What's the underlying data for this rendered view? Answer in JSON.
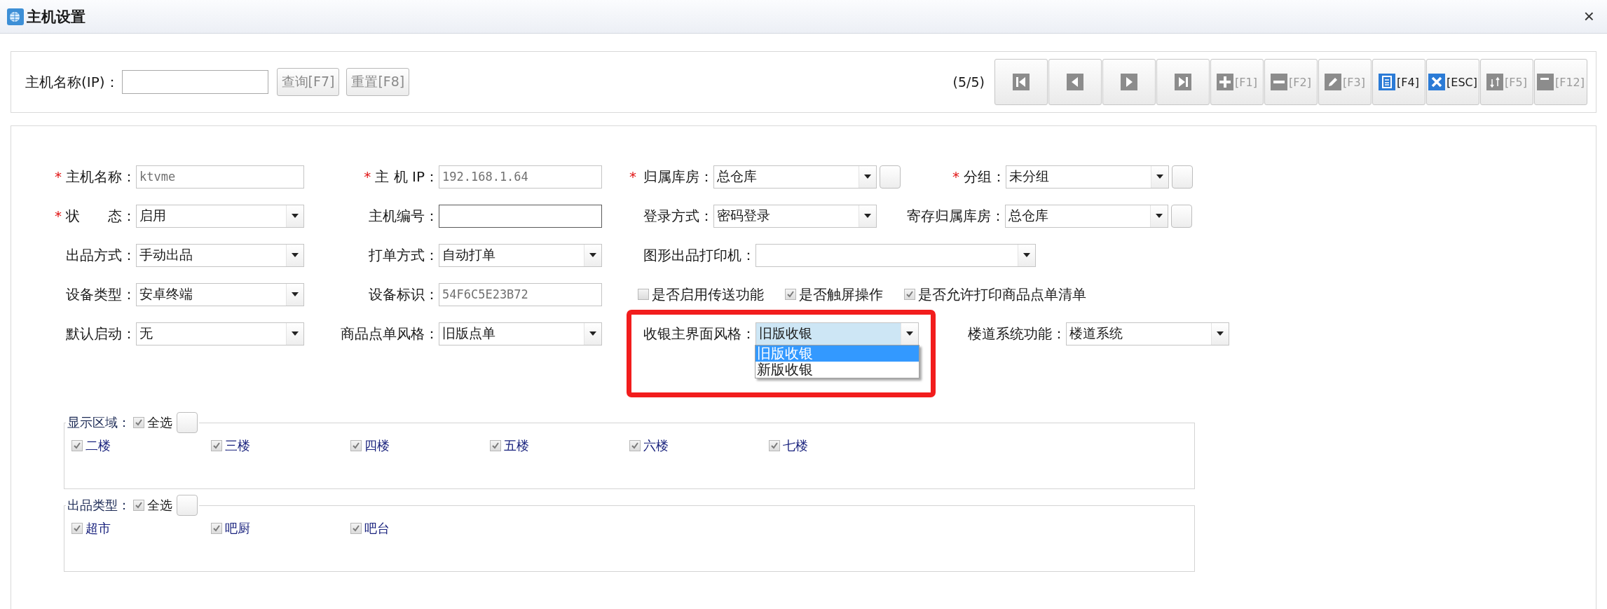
{
  "window": {
    "title": "主机设置",
    "close": "×"
  },
  "search": {
    "label": "主机名称(IP)：",
    "buttons": [
      "查询[F7]",
      "重置[F8]"
    ]
  },
  "pager": {
    "count": "(5/5)"
  },
  "toolbar": [
    {
      "kind": "first"
    },
    {
      "kind": "prev"
    },
    {
      "kind": "next"
    },
    {
      "kind": "last"
    },
    {
      "kind": "add",
      "shortcut": "[F1]",
      "disabled": true
    },
    {
      "kind": "remove",
      "shortcut": "[F2]",
      "disabled": true
    },
    {
      "kind": "edit",
      "shortcut": "[F3]",
      "disabled": true
    },
    {
      "kind": "save",
      "shortcut": "[F4]",
      "disabled": false
    },
    {
      "kind": "cancel",
      "shortcut": "[ESC]",
      "disabled": false
    },
    {
      "kind": "sort",
      "shortcut": "[F5]",
      "disabled": true
    },
    {
      "kind": "collapse",
      "shortcut": "[F12]",
      "disabled": true
    }
  ],
  "form": {
    "required_mark": "*",
    "rows": [
      [
        {
          "kind": "text",
          "label": "主机名称：",
          "value": "ktvme",
          "required": true,
          "disabled": true
        },
        {
          "kind": "text",
          "label": "主 机 IP：",
          "value": "192.168.1.64",
          "required": true,
          "disabled": true
        },
        {
          "kind": "select",
          "label": "归属库房：",
          "value": "总仓库",
          "required": true,
          "extra_button": true
        },
        {
          "kind": "select",
          "label": "分组：",
          "value": "未分组",
          "required": true,
          "extra_button": true
        }
      ],
      [
        {
          "kind": "select",
          "label": "状　　态：",
          "value": "启用",
          "required": true
        },
        {
          "kind": "text",
          "label": "主机编号：",
          "disabled": false
        },
        {
          "kind": "select",
          "label": "登录方式：",
          "value": "密码登录"
        },
        {
          "kind": "select",
          "label": "寄存归属库房：",
          "value": "总仓库",
          "extra_button": true
        }
      ],
      [
        {
          "kind": "select",
          "label": "出品方式：",
          "value": "手动出品"
        },
        {
          "kind": "select",
          "label": "打单方式：",
          "value": "自动打单"
        },
        {
          "kind": "select",
          "label": "图形出品打印机："
        }
      ],
      [
        {
          "kind": "select",
          "label": "设备类型：",
          "value": "安卓终端"
        },
        {
          "kind": "text",
          "label": "设备标识：",
          "value": "54F6C5E23B72",
          "disabled": true
        },
        {
          "kind": "checks",
          "items": [
            {
              "label": "是否启用传送功能",
              "checked": false
            },
            {
              "label": "是否触屏操作",
              "checked": true
            },
            {
              "label": "是否允许打印商品点单清单",
              "checked": true
            }
          ]
        }
      ],
      [
        {
          "kind": "select",
          "label": "默认启动：",
          "value": "无"
        },
        {
          "kind": "select",
          "label": "商品点单风格：",
          "value": "旧版点单"
        },
        {
          "kind": "select",
          "label": "收银主界面风格：",
          "value": "旧版收银",
          "open": true,
          "highlighted": true,
          "options": [
            {
              "label": "旧版收银",
              "selected": true
            },
            {
              "label": "新版收银",
              "selected": false
            }
          ]
        },
        {
          "kind": "select",
          "label": "楼道系统功能：",
          "value": "楼道系统"
        }
      ]
    ]
  },
  "groups": [
    {
      "title": "显示区域：",
      "select_all": {
        "label": "全选",
        "checked": true
      },
      "items": [
        {
          "label": "二楼",
          "checked": true
        },
        {
          "label": "三楼",
          "checked": true
        },
        {
          "label": "四楼",
          "checked": true
        },
        {
          "label": "五楼",
          "checked": true
        },
        {
          "label": "六楼",
          "checked": true
        },
        {
          "label": "七楼",
          "checked": true
        }
      ]
    },
    {
      "title": "出品类型：",
      "select_all": {
        "label": "全选",
        "checked": true
      },
      "items": [
        {
          "label": "超市",
          "checked": true
        },
        {
          "label": "吧厨",
          "checked": true
        },
        {
          "label": "吧台",
          "checked": true
        }
      ]
    }
  ]
}
